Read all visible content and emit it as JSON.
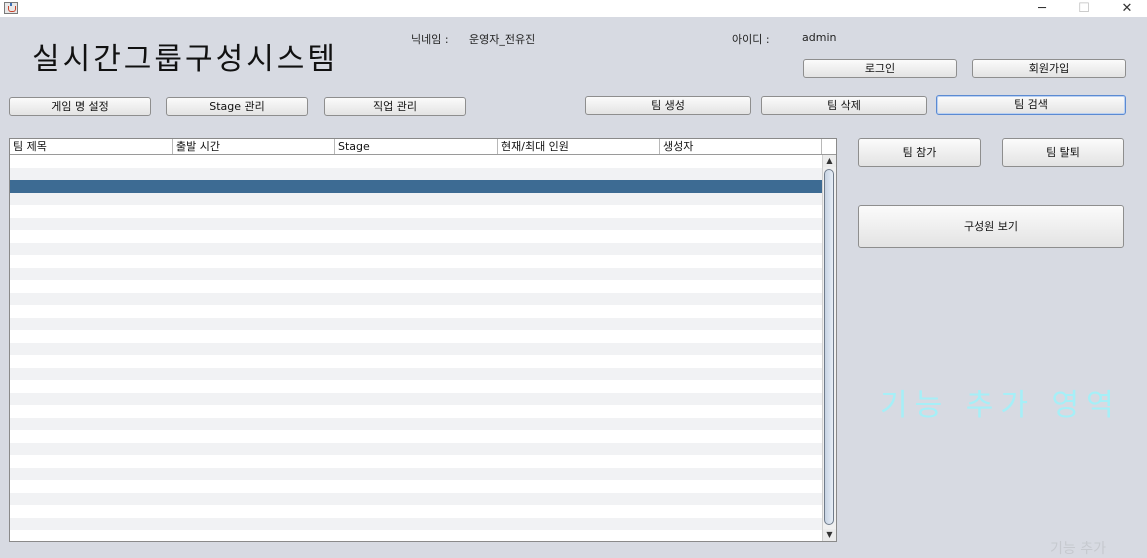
{
  "window": {
    "minimize_glyph": "─",
    "maximize_glyph": "☐",
    "close_glyph": "✕"
  },
  "header": {
    "title": "실시간그룹구성시스템",
    "nickname_label": "닉네임 :",
    "nickname_value": "운영자_전유진",
    "id_label": "아이디 :",
    "id_value": "admin"
  },
  "auth": {
    "login_label": "로그인",
    "signup_label": "회원가입"
  },
  "toolbar": {
    "game_name_settings": "게임 명 설정",
    "stage_manage": "Stage 관리",
    "job_manage": "직업 관리",
    "team_create": "팀 생성",
    "team_delete": "팀 삭제",
    "team_search": "팀 검색"
  },
  "table": {
    "columns": [
      "팀 제목",
      "출발 시간",
      "Stage",
      "현재/최대 인원",
      "생성자"
    ],
    "selected_row_index": 2
  },
  "side": {
    "team_join": "팀 참가",
    "team_leave": "팀 탈퇴",
    "view_members": "구성원 보기",
    "feature_area_text": "기능 추가 영역",
    "faint_bottom_text": "기능 추가"
  },
  "colors": {
    "background": "#d7dae2",
    "selection": "#3d6b93",
    "feature_text": "#a6eff7"
  },
  "icons": {
    "app": "java-coffee-cup-icon",
    "scroll_up": "chevron-up-icon",
    "scroll_down": "chevron-down-icon"
  }
}
